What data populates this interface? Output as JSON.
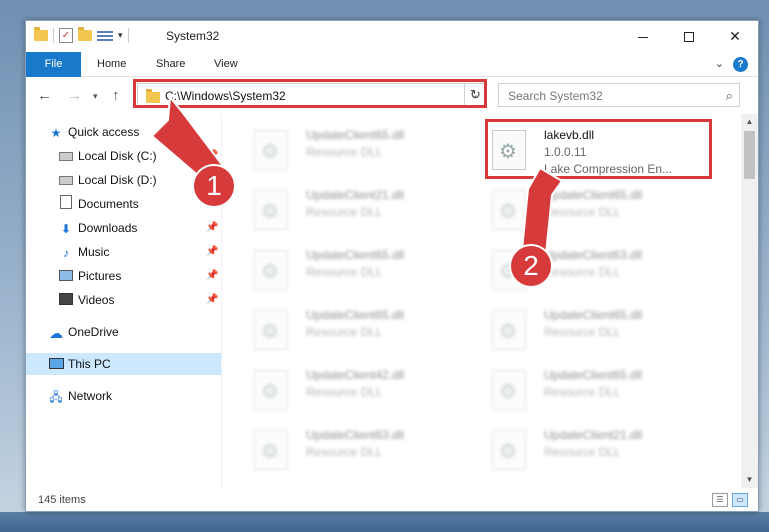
{
  "titlebar": {
    "title": "System32"
  },
  "ribbon": {
    "tabs": [
      "File",
      "Home",
      "Share",
      "View"
    ],
    "help": "?"
  },
  "nav": {
    "address": "C:\\Windows\\System32",
    "search_placeholder": "Search System32"
  },
  "sidebar": {
    "items": [
      {
        "label": "Quick access",
        "icon": "star-icon"
      },
      {
        "label": "Local Disk (C:)",
        "icon": "drive-icon"
      },
      {
        "label": "Local Disk (D:)",
        "icon": "drive-icon"
      },
      {
        "label": "Documents",
        "icon": "document-icon"
      },
      {
        "label": "Downloads",
        "icon": "download-icon"
      },
      {
        "label": "Music",
        "icon": "music-icon"
      },
      {
        "label": "Pictures",
        "icon": "pictures-icon"
      },
      {
        "label": "Videos",
        "icon": "videos-icon"
      },
      {
        "label": "OneDrive",
        "icon": "cloud-icon"
      },
      {
        "label": "This PC",
        "icon": "pc-icon"
      },
      {
        "label": "Network",
        "icon": "network-icon"
      }
    ]
  },
  "files": {
    "left": [
      {
        "name": "UpdateClient65.dll",
        "sub": "Resource DLL"
      },
      {
        "name": "UpdateClient21.dll",
        "sub": "Resource DLL"
      },
      {
        "name": "UpdateClient65.dll",
        "sub": "Resource DLL"
      },
      {
        "name": "UpdateClient65.dll",
        "sub": "Resource DLL"
      },
      {
        "name": "UpdateClient42.dll",
        "sub": "Resource DLL"
      },
      {
        "name": "UpdateClient63.dll",
        "sub": "Resource DLL"
      }
    ],
    "highlighted": {
      "name": "lakevb.dll",
      "version": "1.0.0.11",
      "desc": "Lake Compression En..."
    },
    "right": [
      {
        "name": "UpdateClient65.dll",
        "sub": "Resource DLL"
      },
      {
        "name": "UpdateClient63.dll",
        "sub": "Resource DLL"
      },
      {
        "name": "UpdateClient65.dll",
        "sub": "Resource DLL"
      },
      {
        "name": "UpdateClient65.dll",
        "sub": "Resource DLL"
      },
      {
        "name": "UpdateClient21.dll",
        "sub": "Resource DLL"
      },
      {
        "name": "UpdateClient65.dll",
        "sub": "Resource DLL"
      }
    ]
  },
  "status": {
    "count": "145 items"
  },
  "annotations": {
    "badge1": "1",
    "badge2": "2",
    "highlight_color": "#d63a3a"
  },
  "colors": {
    "accent": "#1979ca",
    "selected": "#cce8ff"
  }
}
